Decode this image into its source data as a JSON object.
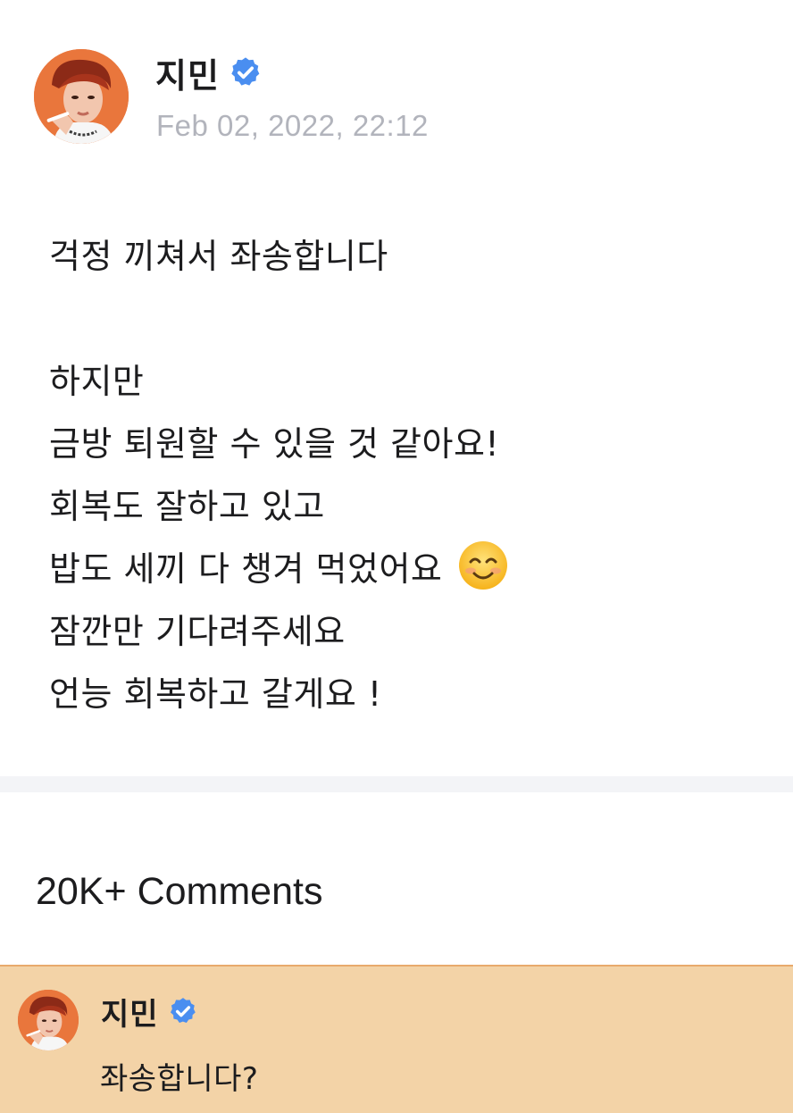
{
  "post": {
    "author": "지민",
    "timestamp": "Feb 02, 2022, 22:12",
    "lines": [
      "걱정 끼쳐서 좌송합니다",
      "",
      "하지만",
      "금방 퇴원할 수 있을 것 같아요!",
      "회복도 잘하고 있고",
      "밥도 세끼 다 챙겨 먹었어요",
      "잠깐만 기다려주세요",
      "언능 회복하고 갈게요 !"
    ],
    "emoji_icon": "smiling-face-emoji"
  },
  "comments": {
    "count_label": "20K+ Comments",
    "highlighted": {
      "author": "지민",
      "text": "좌송합니다?"
    }
  },
  "colors": {
    "verified_blue": "#4a8ef0",
    "timestamp_gray": "#b2b4bc",
    "highlight_bg": "#f3d3a7",
    "highlight_border": "#e8aa6c",
    "avatar_bg": "#e9763c"
  }
}
